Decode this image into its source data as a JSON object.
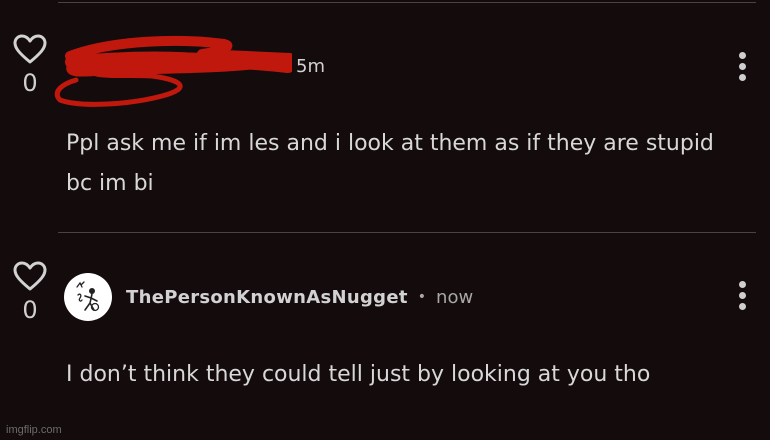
{
  "comments": [
    {
      "username": "",
      "time": "5m",
      "text": "Ppl ask me if im les and i look at them as if they are stupid bc im bi",
      "likes": "0",
      "username_redacted": true
    },
    {
      "username": "ThePersonKnownAsNugget",
      "time": "now",
      "separator": "•",
      "text": "I don’t think they could tell just by looking at you tho",
      "likes": "0",
      "avatar_icon": "doodle-figure-avatar"
    }
  ],
  "icons": {
    "like": "heart-outline-icon",
    "options": "more-vertical-icon"
  },
  "colors": {
    "background": "#140b0c",
    "redaction": "#c0180c",
    "text": "#d8d8d8",
    "muted": "#a8a8a8"
  },
  "watermark": "imgflip.com"
}
